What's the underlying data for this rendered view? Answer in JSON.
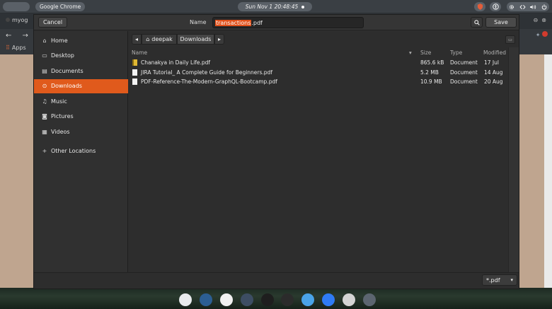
{
  "topbar": {
    "apple_glyph": "",
    "app_name": "Google Chrome",
    "clock": "Sun Nov 1  20:48:45",
    "tray": {
      "icons": [
        "shield-icon",
        "accessibility-icon",
        "settings-icon",
        "network-icon",
        "volume-icon",
        "power-icon"
      ]
    }
  },
  "chrome_bg": {
    "tab_label": "myog",
    "nav_arrows": "← →",
    "apps_label": "Apps"
  },
  "dialog": {
    "cancel_label": "Cancel",
    "save_label": "Save",
    "name_label": "Name",
    "filename": {
      "selected": "transactions",
      "extension": ".pdf"
    },
    "sidebar": [
      {
        "label": "Home",
        "icon": "home-icon",
        "glyph": "⌂",
        "active": false
      },
      {
        "label": "Desktop",
        "icon": "desktop-icon",
        "glyph": "▭",
        "active": false
      },
      {
        "label": "Documents",
        "icon": "documents-icon",
        "glyph": "▤",
        "active": false
      },
      {
        "label": "Downloads",
        "icon": "downloads-icon",
        "glyph": "⊙",
        "active": true
      },
      {
        "label": "Music",
        "icon": "music-icon",
        "glyph": "♫",
        "active": false
      },
      {
        "label": "Pictures",
        "icon": "pictures-icon",
        "glyph": "◙",
        "active": false
      },
      {
        "label": "Videos",
        "icon": "videos-icon",
        "glyph": "▦",
        "active": false
      }
    ],
    "other_locations": "Other Locations",
    "path": {
      "back": "◂",
      "home": "deepak",
      "current": "Downloads",
      "forward": "▸"
    },
    "columns": {
      "name": "Name",
      "size": "Size",
      "type": "Type",
      "modified": "Modified"
    },
    "files": [
      {
        "name": "Chanakya in Daily Life.pdf",
        "size": "865.6 kB",
        "type": "Document",
        "modified": "17 Jul",
        "icon": "pdf-yellow"
      },
      {
        "name": "JIRA Tutorial_ A Complete Guide for Beginners.pdf",
        "size": "5.2 MB",
        "type": "Document",
        "modified": "14 Aug",
        "icon": "pdf-white"
      },
      {
        "name": "PDF-Reference-The-Modern-GraphQL-Bootcamp.pdf",
        "size": "10.9 MB",
        "type": "Document",
        "modified": "20 Aug",
        "icon": "pdf-white"
      }
    ],
    "filter": "*.pdf"
  },
  "dock": [
    {
      "name": "chrome-icon",
      "color": "#e8eaed",
      "glyph": ""
    },
    {
      "name": "globe-icon",
      "color": "#2c5e93",
      "glyph": ""
    },
    {
      "name": "mongodb-icon",
      "color": "#f1f1f1",
      "glyph": ""
    },
    {
      "name": "app-icon",
      "color": "#3d4d63",
      "glyph": ""
    },
    {
      "name": "vscode-icon",
      "color": "#1e1e1e",
      "glyph": ""
    },
    {
      "name": "terminal-icon",
      "color": "#2b2b2b",
      "glyph": ""
    },
    {
      "name": "finder-icon",
      "color": "#4aa3e8",
      "glyph": ""
    },
    {
      "name": "appstore-icon",
      "color": "#2f7bf5",
      "glyph": ""
    },
    {
      "name": "trash-icon",
      "color": "#d4d4d4",
      "glyph": ""
    },
    {
      "name": "launchpad-icon",
      "color": "#5c6570",
      "glyph": ""
    }
  ]
}
